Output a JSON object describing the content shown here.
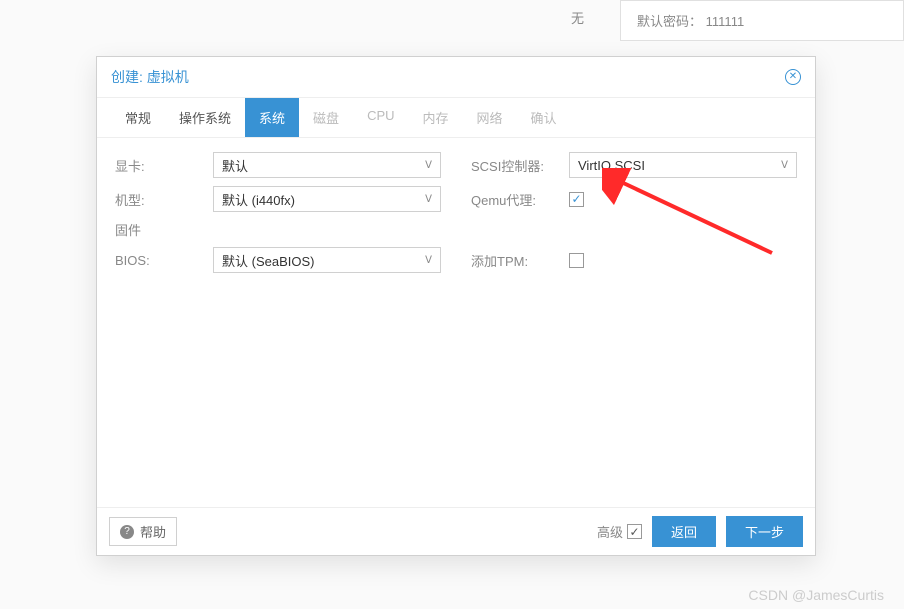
{
  "bg": {
    "left": "无",
    "right_label": "默认密码：",
    "right_value": "111111"
  },
  "dialog": {
    "title": "创建: 虚拟机",
    "tabs": {
      "general": "常规",
      "os": "操作系统",
      "system": "系统",
      "disk": "磁盘",
      "cpu": "CPU",
      "memory": "内存",
      "network": "网络",
      "confirm": "确认"
    },
    "fields": {
      "gpu_label": "显卡:",
      "gpu_value": "默认",
      "model_label": "机型:",
      "model_value": "默认 (i440fx)",
      "firmware_label": "固件",
      "bios_label": "BIOS:",
      "bios_value": "默认 (SeaBIOS)",
      "scsi_label": "SCSI控制器:",
      "scsi_value": "VirtIO SCSI",
      "qemu_label": "Qemu代理:",
      "tpm_label": "添加TPM:"
    },
    "footer": {
      "help": "帮助",
      "advanced": "高级",
      "back": "返回",
      "next": "下一步"
    }
  },
  "watermark": "CSDN @JamesCurtis"
}
